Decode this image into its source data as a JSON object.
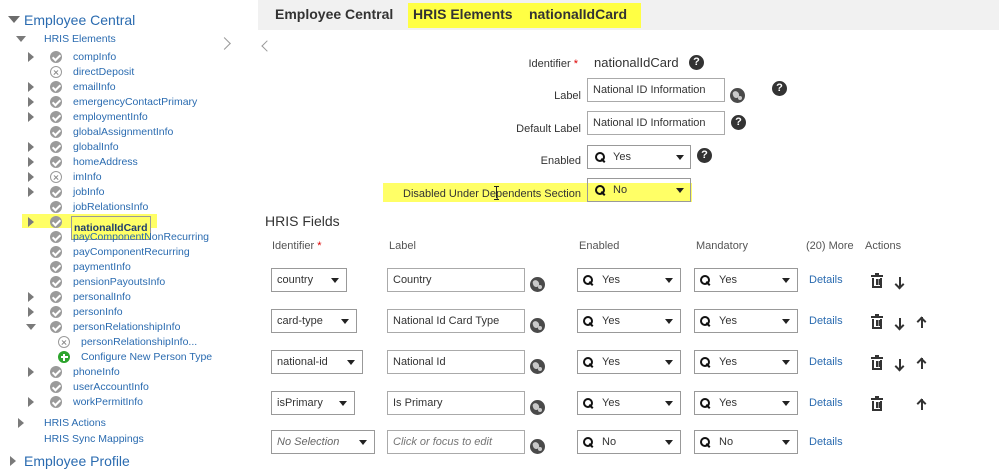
{
  "colors": {
    "highlight": "#ffff66",
    "link": "#2a6bb0",
    "required": "#d00000"
  },
  "sidebar": {
    "root_label": "Employee Central",
    "group_label": "HRIS Elements",
    "items": [
      {
        "label": "compInfo",
        "state": "enabled",
        "expandable": true
      },
      {
        "label": "directDeposit",
        "state": "disabled",
        "expandable": false
      },
      {
        "label": "emailInfo",
        "state": "enabled",
        "expandable": true
      },
      {
        "label": "emergencyContactPrimary",
        "state": "enabled",
        "expandable": true
      },
      {
        "label": "employmentInfo",
        "state": "enabled",
        "expandable": true
      },
      {
        "label": "globalAssignmentInfo",
        "state": "enabled",
        "expandable": false
      },
      {
        "label": "globalInfo",
        "state": "enabled",
        "expandable": true
      },
      {
        "label": "homeAddress",
        "state": "enabled",
        "expandable": true
      },
      {
        "label": "imInfo",
        "state": "disabled",
        "expandable": true
      },
      {
        "label": "jobInfo",
        "state": "enabled",
        "expandable": true
      },
      {
        "label": "jobRelationsInfo",
        "state": "enabled",
        "expandable": false
      },
      {
        "label": "nationalIdCard",
        "state": "enabled",
        "expandable": true,
        "selected": true
      },
      {
        "label": "payComponentNonRecurring",
        "state": "enabled",
        "expandable": false
      },
      {
        "label": "payComponentRecurring",
        "state": "enabled",
        "expandable": false
      },
      {
        "label": "paymentInfo",
        "state": "enabled",
        "expandable": false
      },
      {
        "label": "pensionPayoutsInfo",
        "state": "enabled",
        "expandable": false
      },
      {
        "label": "personalInfo",
        "state": "enabled",
        "expandable": true
      },
      {
        "label": "personInfo",
        "state": "enabled",
        "expandable": true
      },
      {
        "label": "personRelationshipInfo",
        "state": "enabled",
        "expandable": true,
        "expanded": true
      },
      {
        "label": "personRelationshipInfo...",
        "state": "disabled",
        "child": true
      },
      {
        "label": "Configure New Person Type",
        "state": "add",
        "child": true
      },
      {
        "label": "phoneInfo",
        "state": "enabled",
        "expandable": true
      },
      {
        "label": "userAccountInfo",
        "state": "enabled",
        "expandable": false
      },
      {
        "label": "workPermitInfo",
        "state": "enabled",
        "expandable": true
      }
    ],
    "hris_actions_label": "HRIS Actions",
    "hris_sync_label": "HRIS Sync Mappings",
    "employee_profile_label": "Employee Profile"
  },
  "header": {
    "crumb_1": "Employee Central",
    "crumb_2": "HRIS Elements",
    "crumb_3": "nationalIdCard"
  },
  "form": {
    "identifier_label": "Identifier",
    "required_mark": "*",
    "identifier_value": "nationalIdCard",
    "label_label": "Label",
    "label_value": "National ID Information",
    "default_label_label": "Default Label",
    "default_label_value": "National ID Information",
    "enabled_label": "Enabled",
    "enabled_value": "Yes",
    "disabled_dependents_label": "Disabled Under Dependents Section",
    "disabled_dependents_value": "No",
    "help_glyph": "?"
  },
  "fields": {
    "section_title": "HRIS Fields",
    "columns": {
      "identifier": "Identifier",
      "label": "Label",
      "enabled": "Enabled",
      "mandatory": "Mandatory",
      "more": "(20) More",
      "actions": "Actions"
    },
    "details_label": "Details",
    "rows": [
      {
        "identifier": "country",
        "label": "Country",
        "enabled": "Yes",
        "mandatory": "Yes",
        "up": false,
        "down": true,
        "delete": true
      },
      {
        "identifier": "card-type",
        "label": "National Id Card Type",
        "enabled": "Yes",
        "mandatory": "Yes",
        "up": true,
        "down": true,
        "delete": true
      },
      {
        "identifier": "national-id",
        "label": "National Id",
        "enabled": "Yes",
        "mandatory": "Yes",
        "up": true,
        "down": true,
        "delete": true
      },
      {
        "identifier": "isPrimary",
        "label": "Is Primary",
        "enabled": "Yes",
        "mandatory": "Yes",
        "up": true,
        "down": false,
        "delete": true
      }
    ],
    "new_row": {
      "identifier_placeholder": "No Selection",
      "label_placeholder": "Click or focus to edit",
      "enabled": "No",
      "mandatory": "No"
    }
  }
}
